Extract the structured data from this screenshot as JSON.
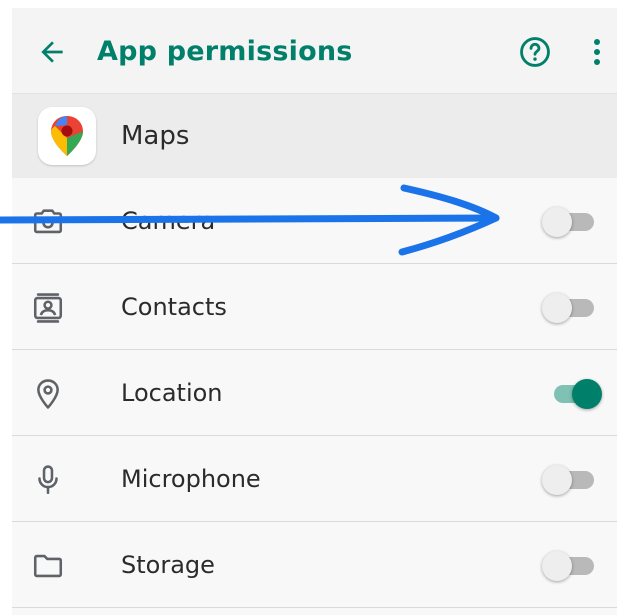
{
  "appbar": {
    "title": "App permissions",
    "back_icon": "arrow-back-icon",
    "help_icon": "help-circle-icon",
    "more_icon": "more-vert-icon"
  },
  "app": {
    "name": "Maps",
    "icon": "google-maps-logo"
  },
  "permissions": [
    {
      "label": "Camera",
      "icon": "camera-icon",
      "enabled": false
    },
    {
      "label": "Contacts",
      "icon": "contacts-icon",
      "enabled": false
    },
    {
      "label": "Location",
      "icon": "location-pin-icon",
      "enabled": true
    },
    {
      "label": "Microphone",
      "icon": "microphone-icon",
      "enabled": false
    },
    {
      "label": "Storage",
      "icon": "folder-icon",
      "enabled": false
    }
  ],
  "colors": {
    "accent": "#00806a",
    "accent_track": "#7fc1b3",
    "annotation_arrow": "#1a73e8"
  }
}
